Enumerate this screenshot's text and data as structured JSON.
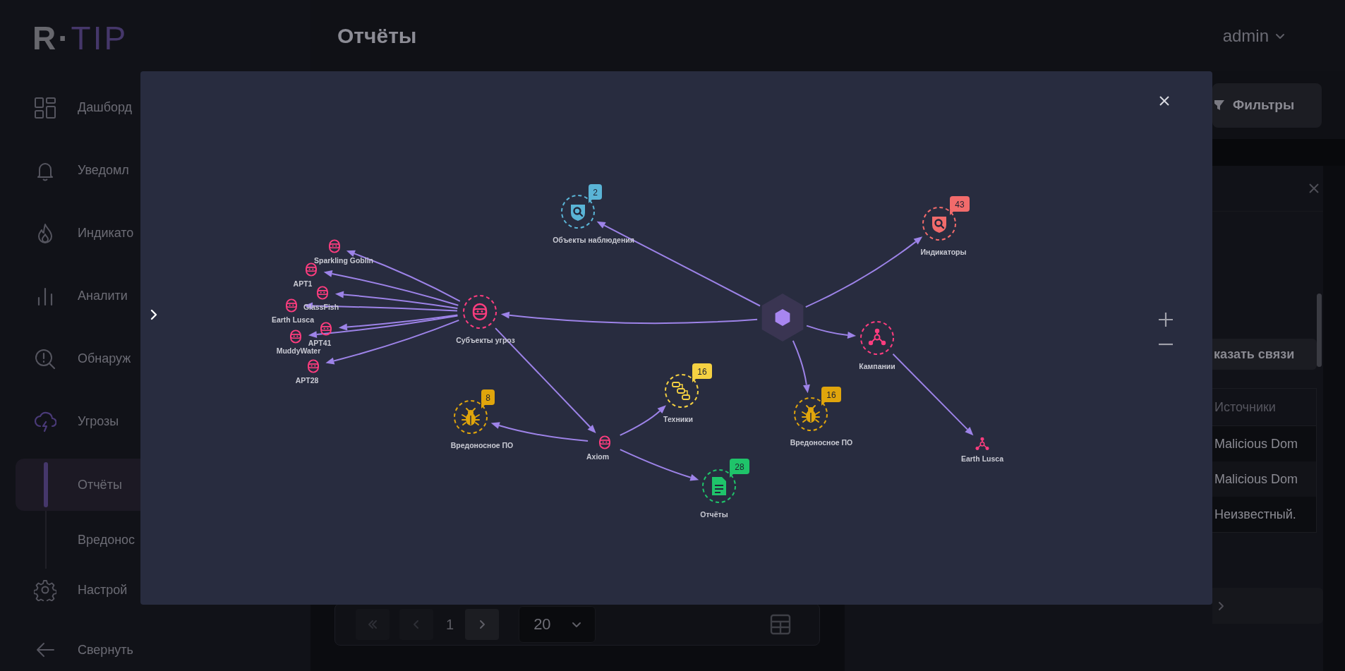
{
  "logo": {
    "prefix": "R·",
    "suffix": "TIP"
  },
  "sidebar": {
    "items": [
      {
        "label": "Дашборд",
        "selected": false
      },
      {
        "label": "Уведомл",
        "selected": false
      },
      {
        "label": "Индикато",
        "selected": false
      },
      {
        "label": "Аналити",
        "selected": false
      },
      {
        "label": "Обнаруж",
        "selected": false
      },
      {
        "label": "Угрозы",
        "selected": false,
        "expanded": true,
        "children": [
          {
            "label": "Отчёты",
            "selected": true
          },
          {
            "label": "Вредонос",
            "selected": false
          }
        ]
      },
      {
        "label": "Настрой",
        "selected": false
      }
    ],
    "collapse": "Свернуть"
  },
  "header": {
    "title": "Отчёты",
    "user": "admin"
  },
  "toolbar": {
    "filters": "Фильтры"
  },
  "details": {
    "links_button": "казать связи",
    "table": {
      "columns": [
        "Источники"
      ],
      "rows": [
        "Malicious Dom",
        "Malicious Dom",
        "Неизвестный."
      ]
    }
  },
  "pager": {
    "page": "1",
    "page_size": "20"
  },
  "graph": {
    "root": {
      "kind": "hub",
      "color": "#a886f0",
      "children": [
        {
          "kind": "observable",
          "circled": true,
          "label": "Объекты наблюдения",
          "color": "#5ab4d6",
          "badge": "2"
        },
        {
          "kind": "indicator",
          "circled": true,
          "label": "Индикаторы",
          "color": "#f26b6b",
          "badge": "43"
        },
        {
          "kind": "threat_actor",
          "circled": true,
          "label": "Субъекты угроз",
          "color": "#ff3d7f",
          "children": [
            {
              "kind": "threat_actor",
              "circled": false,
              "label": "Axiom",
              "color": "#ff3d7f",
              "children": [
                {
                  "kind": "malware",
                  "circled": true,
                  "label": "Вредоносное ПО",
                  "color": "#e0a50c",
                  "badge": "8"
                },
                {
                  "kind": "technique",
                  "circled": true,
                  "label": "Техники",
                  "color": "#f5d142",
                  "badge": "16"
                },
                {
                  "kind": "report",
                  "circled": true,
                  "label": "Отчёты",
                  "color": "#1fc46a",
                  "badge": "28"
                }
              ]
            },
            {
              "kind": "threat_actor",
              "circled": false,
              "label": "Sparkling Goblin",
              "color": "#ff3d7f"
            },
            {
              "kind": "threat_actor",
              "circled": false,
              "label": "APT1",
              "color": "#ff3d7f"
            },
            {
              "kind": "threat_actor",
              "circled": false,
              "label": "GlassFish",
              "color": "#ff3d7f"
            },
            {
              "kind": "threat_actor",
              "circled": false,
              "label": "Earth Lusca",
              "color": "#ff3d7f"
            },
            {
              "kind": "threat_actor",
              "circled": false,
              "label": "APT41",
              "color": "#ff3d7f"
            },
            {
              "kind": "threat_actor",
              "circled": false,
              "label": "MuddyWater",
              "color": "#ff3d7f"
            },
            {
              "kind": "threat_actor",
              "circled": false,
              "label": "APT28",
              "color": "#ff3d7f"
            }
          ]
        },
        {
          "kind": "campaign",
          "circled": true,
          "label": "Кампании",
          "color": "#ff3d7f",
          "children": [
            {
              "kind": "campaign",
              "circled": false,
              "label": "Earth Lusca",
              "color": "#ff3d7f"
            }
          ]
        },
        {
          "kind": "malware",
          "circled": true,
          "label": "Вредоносное ПО",
          "color": "#e0a50c",
          "badge": "16"
        }
      ]
    }
  }
}
